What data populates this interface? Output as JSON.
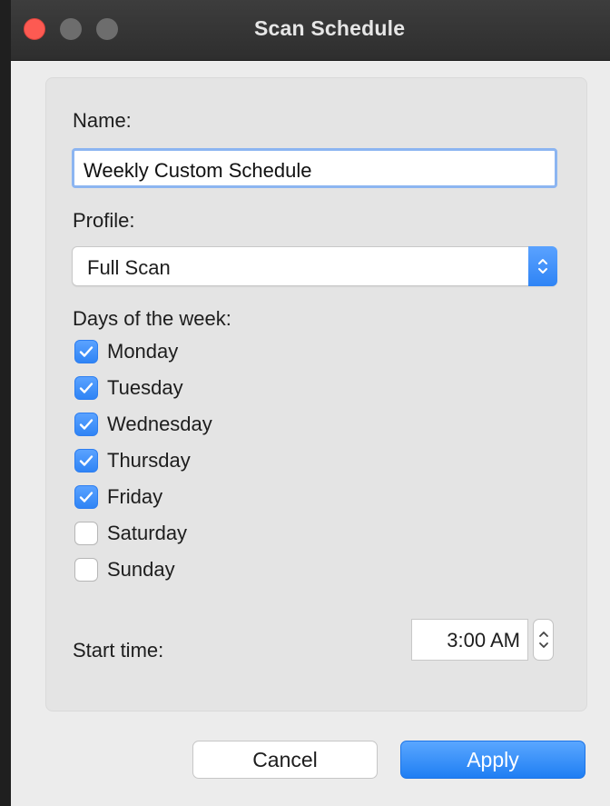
{
  "window": {
    "title": "Scan Schedule"
  },
  "form": {
    "name_label": "Name:",
    "name_value": "Weekly Custom Schedule",
    "profile_label": "Profile:",
    "profile_value": "Full Scan",
    "days_label": "Days of the week:",
    "days": [
      {
        "label": "Monday",
        "checked": true
      },
      {
        "label": "Tuesday",
        "checked": true
      },
      {
        "label": "Wednesday",
        "checked": true
      },
      {
        "label": "Thursday",
        "checked": true
      },
      {
        "label": "Friday",
        "checked": true
      },
      {
        "label": "Saturday",
        "checked": false
      },
      {
        "label": "Sunday",
        "checked": false
      }
    ],
    "start_time_label": "Start time:",
    "start_time_value": "3:00 AM"
  },
  "buttons": {
    "cancel": "Cancel",
    "apply": "Apply"
  },
  "colors": {
    "accent": "#3b8ef7",
    "close_light": "#fd5a52",
    "titlebar": "#333333"
  },
  "icons": {
    "check": "checkmark-icon",
    "select_arrows": "up-down-chevron-icon",
    "stepper": "stepper-arrows-icon"
  }
}
